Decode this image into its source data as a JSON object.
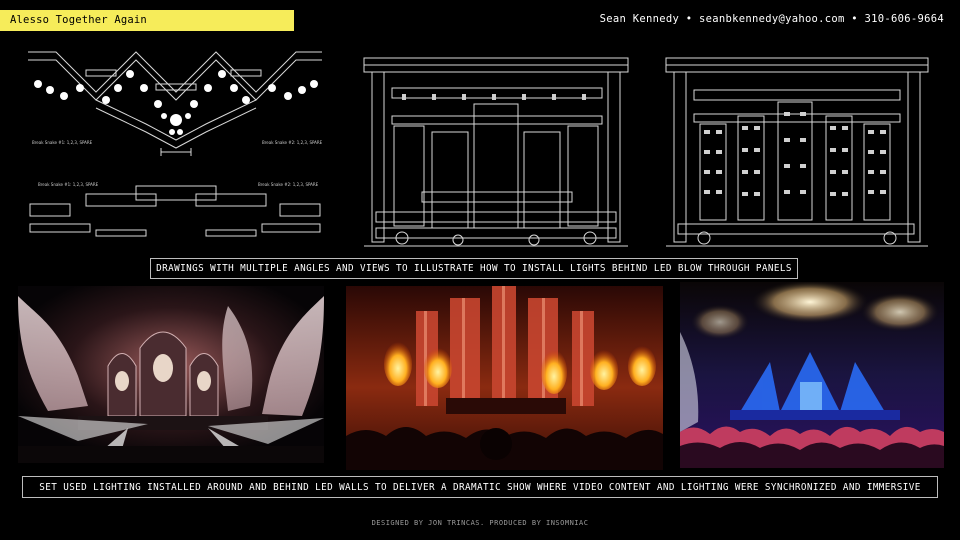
{
  "header": {
    "title": "Alesso Together Again",
    "contact": "Sean Kennedy • seanbkennedy@yahoo.com • 310-606-9664"
  },
  "drawings": {
    "plan_view": {
      "label_left_top": "Break Snake #1: 1,2,3, SPARE",
      "label_right_top": "Break Snake #2: 1,2,3, SPARE",
      "label_left_bottom": "Break Snake #1: 1,2,3, SPARE",
      "label_right_bottom": "Break Snake #2: 1,2,3, SPARE"
    },
    "caption": "DRAWINGS WITH MULTIPLE ANGLES AND VIEWS TO ILLUSTRATE HOW TO INSTALL LIGHTS BEHIND LED BLOW THROUGH PANELS"
  },
  "photos": {
    "caption": "SET USED LIGHTING INSTALLED AROUND AND BEHIND LED WALLS TO DELIVER A DRAMATIC SHOW WHERE VIDEO CONTENT AND LIGHTING WERE SYNCHRONIZED AND IMMERSIVE"
  },
  "footer": {
    "credit": "DESIGNED BY JON TRINCAS. PRODUCED BY INSOMNIAC"
  },
  "colors": {
    "accent_yellow": "#f6ec5a",
    "background": "#000000",
    "caption_border": "#bdbdbd"
  }
}
